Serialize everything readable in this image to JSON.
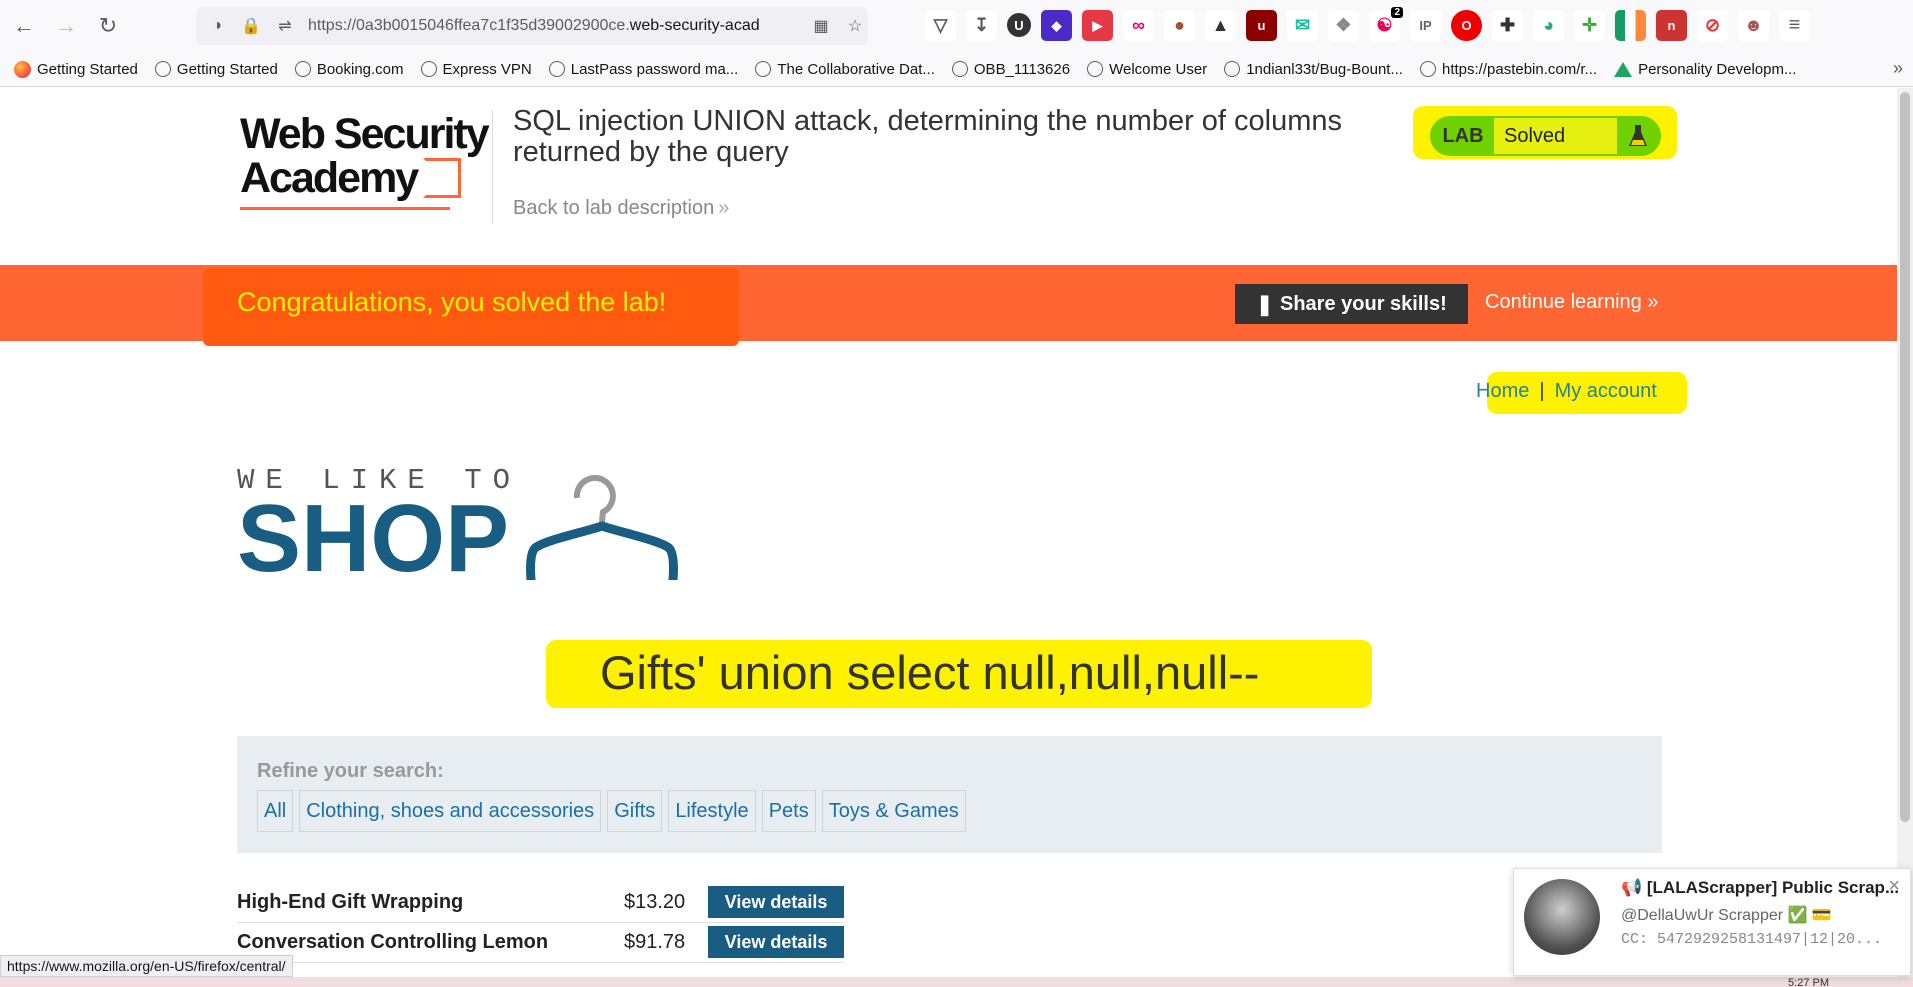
{
  "browser": {
    "url_prefix": "https://0a3b0015046ffea7c1f35d39002900ce.",
    "url_domain": "web-security-acad",
    "bookmarks": [
      {
        "label": "Getting Started",
        "icon": "firefox-icon"
      },
      {
        "label": "Getting Started",
        "icon": "globe-icon"
      },
      {
        "label": "Booking.com",
        "icon": "globe-icon"
      },
      {
        "label": "Express VPN",
        "icon": "globe-icon"
      },
      {
        "label": "LastPass password ma...",
        "icon": "globe-icon"
      },
      {
        "label": "The Collaborative Dat...",
        "icon": "globe-icon"
      },
      {
        "label": "OBB_1113626",
        "icon": "globe-icon"
      },
      {
        "label": "Welcome User",
        "icon": "globe-icon"
      },
      {
        "label": "1ndianl33t/Bug-Bount...",
        "icon": "globe-icon"
      },
      {
        "label": "https://pastebin.com/r...",
        "icon": "globe-icon"
      },
      {
        "label": "Personality Developm...",
        "icon": "google-drive-icon"
      }
    ],
    "extension_badge": "2",
    "status_url": "https://www.mozilla.org/en-US/firefox/central/"
  },
  "header": {
    "logo_line1": "Web Security",
    "logo_line2": "Academy",
    "lab_title": "SQL injection UNION attack, determining the number of columns returned by the query",
    "back_link": "Back to lab description",
    "lab_tag": "LAB",
    "lab_status": "Solved"
  },
  "banner": {
    "message": "Congratulations, you solved the lab!",
    "share_label": "Share your skills!",
    "continue_label": "Continue learning"
  },
  "nav": {
    "home": "Home",
    "separator": "|",
    "account": "My account"
  },
  "shop": {
    "tagline": "WE LIKE TO",
    "name": "SHOP"
  },
  "search_heading": "Gifts' union select null,null,null--",
  "refine": {
    "label": "Refine your search:",
    "categories": [
      "All",
      "Clothing, shoes and accessories",
      "Gifts",
      "Lifestyle",
      "Pets",
      "Toys & Games"
    ]
  },
  "products": [
    {
      "name": "High-End Gift Wrapping",
      "price": "$13.20",
      "button": "View details"
    },
    {
      "name": "Conversation Controlling Lemon",
      "price": "$91.78",
      "button": "View details"
    }
  ],
  "notification": {
    "title": "📢 [LALAScrapper] Public Scrap...",
    "subtitle": "@DellaUwUr Scrapper ✅ 💳",
    "body": "CC: 5472929258131497|12|20..."
  },
  "taskbar_time": "5:27 PM",
  "colors": {
    "accent_orange": "#ff6633",
    "shop_blue": "#1a5d82",
    "highlight_yellow": "#fff200",
    "lab_green": "#70d100"
  }
}
